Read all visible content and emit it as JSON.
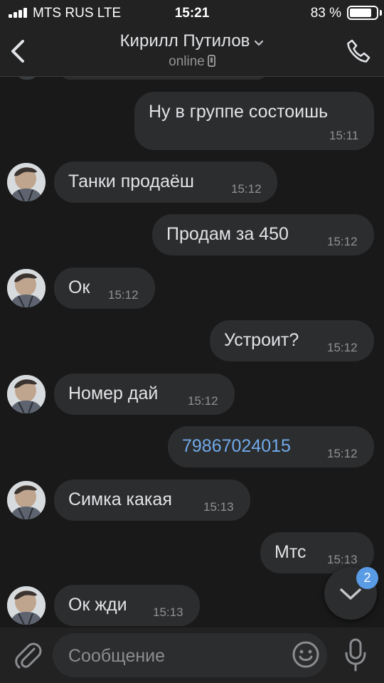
{
  "status": {
    "carrier": "MTS RUS  LTE",
    "time": "15:21",
    "battery": "83 %",
    "battery_level": 0.83
  },
  "header": {
    "contact_name": "Кирилл Путилов",
    "presence": "online",
    "icons": [
      "back-icon",
      "chevron-down-icon",
      "mobile-icon",
      "phone-call-icon"
    ]
  },
  "messages": [
    {
      "side": "out",
      "text": "Ну в группе состоишь",
      "time": "15:11"
    },
    {
      "side": "in",
      "text": "Танки продаёш",
      "time": "15:12"
    },
    {
      "side": "out",
      "text": "Продам за 450",
      "time": "15:12"
    },
    {
      "side": "in",
      "text": "Ок",
      "time": "15:12"
    },
    {
      "side": "out",
      "text": "Устроит?",
      "time": "15:12"
    },
    {
      "side": "in",
      "text": "Номер дай",
      "time": "15:12"
    },
    {
      "side": "out",
      "text": "79867024015",
      "time": "15:12",
      "is_link": true
    },
    {
      "side": "in",
      "text": "Симка какая",
      "time": "15:13"
    },
    {
      "side": "out",
      "text": "Мтс",
      "time": "15:13"
    },
    {
      "side": "in",
      "text": "Ок жди",
      "time": "15:13"
    }
  ],
  "scroll_down": {
    "badge": "2"
  },
  "composer": {
    "placeholder": "Сообщение",
    "icons": [
      "paperclip-icon",
      "emoji-icon",
      "microphone-icon"
    ]
  },
  "colors": {
    "background": "#19191a",
    "bubble": "#2c2d2e",
    "accent": "#5a9be6",
    "link": "#71aaeb"
  }
}
